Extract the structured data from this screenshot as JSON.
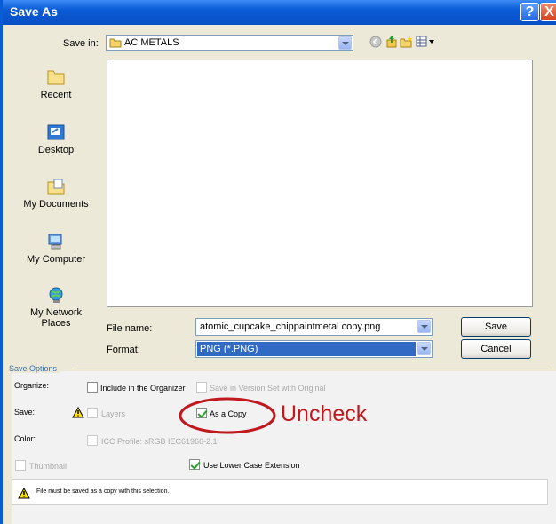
{
  "window": {
    "title": "Save As",
    "help_label": "?",
    "close_label": "X"
  },
  "save_in": {
    "label": "Save in:",
    "value": "AC METALS"
  },
  "places": [
    {
      "label": "Recent",
      "icon": "folder-icon"
    },
    {
      "label": "Desktop",
      "icon": "desktop-icon"
    },
    {
      "label": "My Documents",
      "icon": "my-documents-icon"
    },
    {
      "label": "My Computer",
      "icon": "computer-icon"
    },
    {
      "label": "My Network Places",
      "icon": "network-icon"
    }
  ],
  "filename": {
    "label": "File name:",
    "value": "atomic_cupcake_chippaintmetal copy.png"
  },
  "format": {
    "label": "Format:",
    "value": "PNG (*.PNG)"
  },
  "buttons": {
    "save": "Save",
    "cancel": "Cancel"
  },
  "save_options": {
    "title": "Save Options",
    "organize_label": "Organize:",
    "include_organizer": "Include in the Organizer",
    "save_version_set": "Save in Version Set with Original",
    "save_label": "Save:",
    "layers": "Layers",
    "as_copy": "As a Copy",
    "annotation": "Uncheck",
    "color_label": "Color:",
    "icc_profile": "ICC Profile:  sRGB IEC61966-2.1",
    "thumbnail": "Thumbnail",
    "lower_case": "Use Lower Case Extension",
    "warning": "File must be saved as a copy with this selection."
  },
  "colors": {
    "titlebar": "#0a5bd6",
    "annotation": "#c0181c",
    "selected": "#316ac5"
  }
}
